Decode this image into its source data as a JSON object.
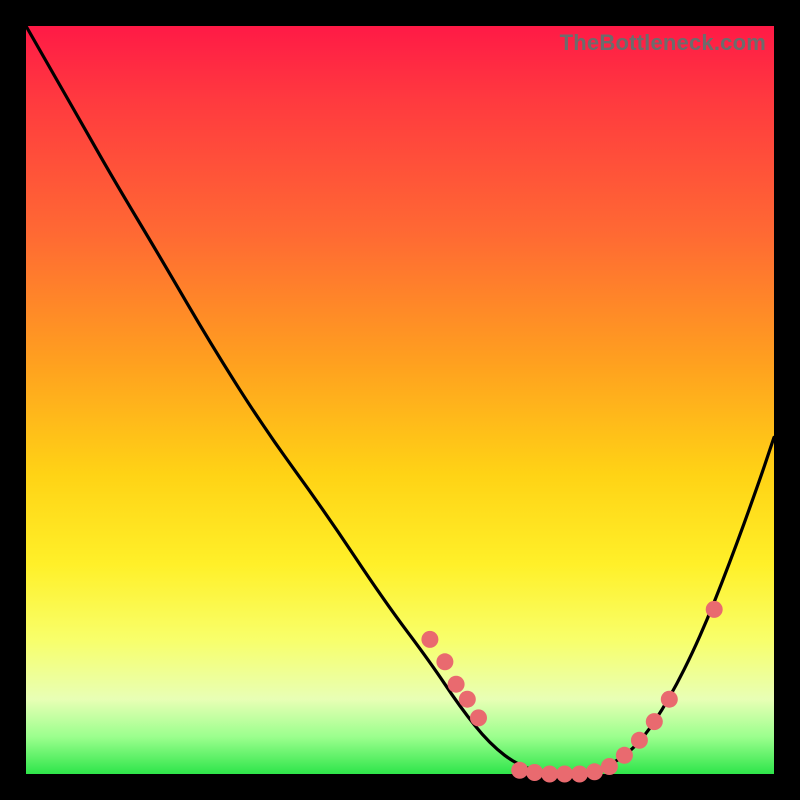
{
  "watermark": "TheBottleneck.com",
  "colors": {
    "frame": "#000000",
    "curve": "#000000",
    "dot_fill": "#e96a6f",
    "dot_stroke": "#c44f55"
  },
  "chart_data": {
    "type": "line",
    "title": "",
    "xlabel": "",
    "ylabel": "",
    "xlim": [
      0,
      100
    ],
    "ylim": [
      0,
      100
    ],
    "note": "Single V-shaped curve; y-axis is inverted visually (low values near bottom = green/good, high = red). Values are in percent of plot area height from top (0) to bottom (100). x is percent of plot width.",
    "series": [
      {
        "name": "bottleneck-curve",
        "x": [
          0,
          4,
          8,
          12,
          18,
          25,
          32,
          40,
          48,
          54,
          58,
          62,
          66,
          70,
          74,
          78,
          82,
          86,
          90,
          94,
          98,
          100
        ],
        "y": [
          0,
          7,
          14,
          21,
          31,
          43,
          54,
          65,
          77,
          85,
          91,
          96,
          99,
          100,
          100,
          99,
          96,
          90,
          82,
          72,
          61,
          55
        ]
      }
    ],
    "dots": {
      "note": "Highlighted sample points along the curve near the trough and shoulders.",
      "x": [
        54,
        56,
        57.5,
        59,
        60.5,
        66,
        68,
        70,
        72,
        74,
        76,
        78,
        80,
        82,
        84,
        86,
        92
      ],
      "y": [
        82,
        85,
        88,
        90,
        92.5,
        99.5,
        99.8,
        100,
        100,
        100,
        99.7,
        99,
        97.5,
        95.5,
        93,
        90,
        78
      ]
    }
  }
}
